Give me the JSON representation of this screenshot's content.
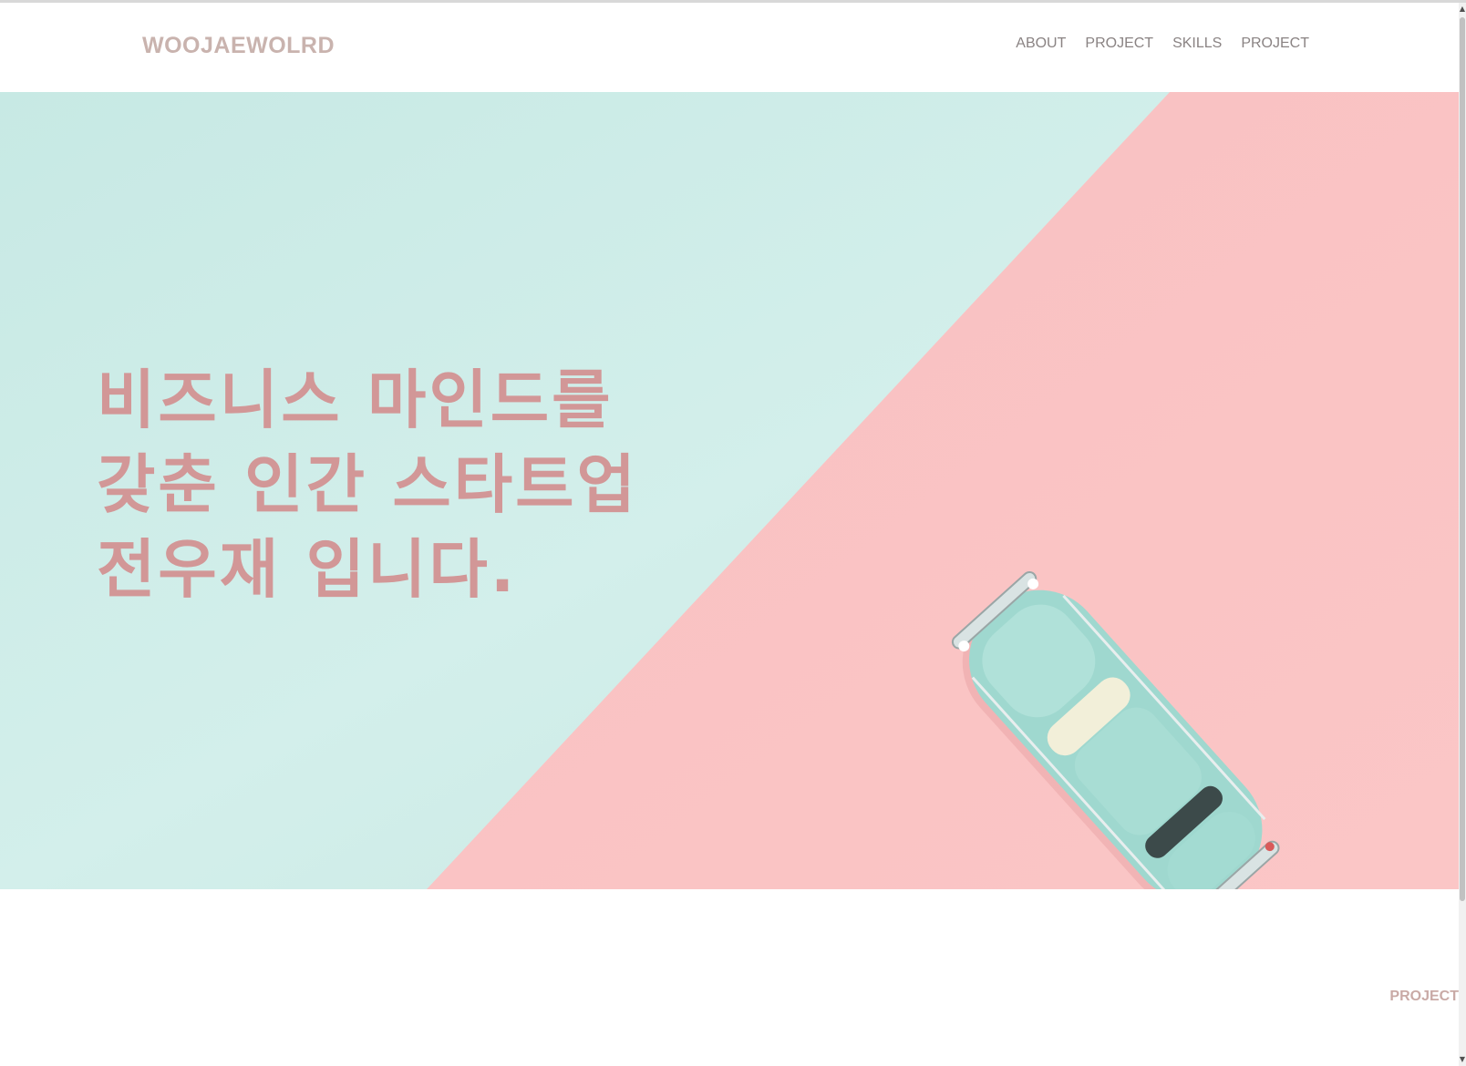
{
  "header": {
    "logo": "WOOJAEWOLRD",
    "nav": [
      {
        "label": "ABOUT"
      },
      {
        "label": "PROJECT"
      },
      {
        "label": "SKILLS"
      },
      {
        "label": "PROJECT"
      }
    ]
  },
  "hero": {
    "lines": [
      "비즈니스 마인드를",
      "갖춘 인간 스타트업",
      "전우재 입니다."
    ],
    "colors": {
      "mint": "#cdebe6",
      "pink": "#f9c3c3",
      "text": "#d29797"
    },
    "image": "toy-car-icon"
  },
  "section": {
    "label": "PROJECT"
  },
  "scrollbar": {
    "up_icon": "▲",
    "down_icon": "▼"
  }
}
